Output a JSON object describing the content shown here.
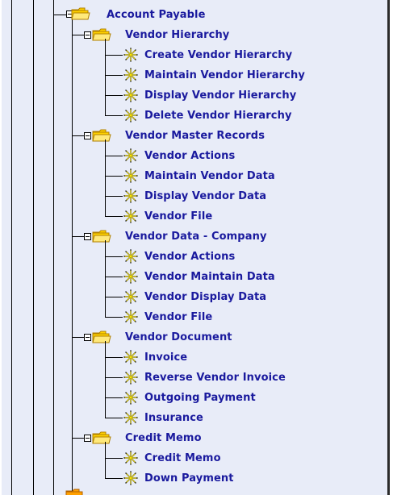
{
  "tree": {
    "root_label": "Account Payable",
    "groups": [
      {
        "label": "Vendor Hierarchy",
        "children": [
          "Create Vendor Hierarchy",
          "Maintain Vendor Hierarchy",
          "Display Vendor Hierarchy",
          "Delete Vendor Hierarchy"
        ]
      },
      {
        "label": "Vendor Master Records",
        "children": [
          "Vendor Actions",
          "Maintain Vendor Data",
          "Display Vendor Data",
          "Vendor File"
        ]
      },
      {
        "label": "Vendor Data - Company",
        "children": [
          "Vendor Actions",
          "Vendor Maintain Data",
          "Vendor Display Data",
          "Vendor File"
        ]
      },
      {
        "label": "Vendor Document",
        "children": [
          "Invoice",
          "Reverse Vendor Invoice",
          "Outgoing Payment",
          "Insurance"
        ]
      },
      {
        "label": "Credit Memo",
        "children": [
          "Credit Memo",
          "Down Payment"
        ]
      }
    ]
  },
  "icons": {
    "folder": "folder-icon",
    "transaction": "transaction-star-icon",
    "expander": "collapse-toggle-icon"
  },
  "colors": {
    "background": "#e8ecf8",
    "label_text": "#1a1a9e",
    "folder_fill": "#ffd200",
    "star_fill": "#ffe800"
  }
}
